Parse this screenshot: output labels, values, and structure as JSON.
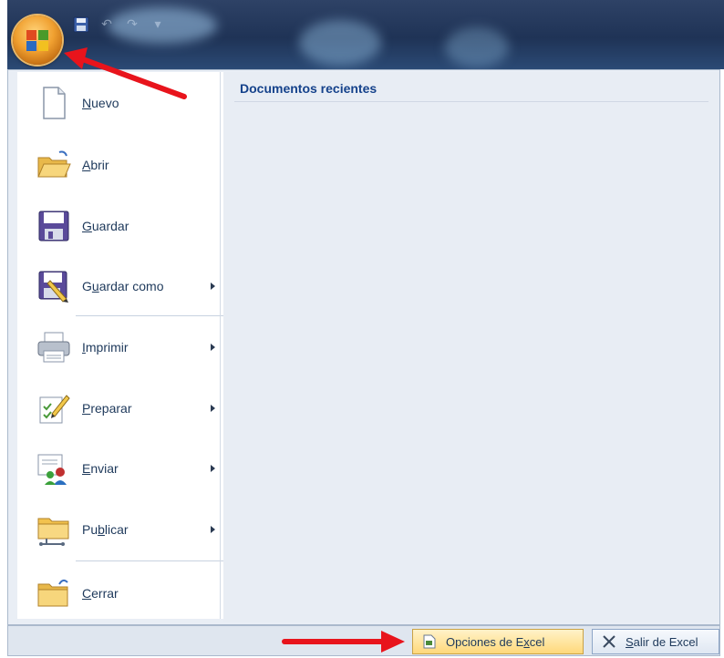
{
  "window": {
    "quick_access_glyphs": [
      "↶",
      "↷",
      "▾"
    ]
  },
  "recent": {
    "title": "Documentos recientes"
  },
  "menu": {
    "items": [
      {
        "key": "nuevo",
        "pre": "",
        "ul": "N",
        "post": "uevo",
        "icon": "new-document-icon",
        "submenu": false
      },
      {
        "key": "abrir",
        "pre": "",
        "ul": "A",
        "post": "brir",
        "icon": "open-folder-icon",
        "submenu": false
      },
      {
        "key": "guardar",
        "pre": "",
        "ul": "G",
        "post": "uardar",
        "icon": "save-icon",
        "submenu": false
      },
      {
        "key": "guardar-como",
        "pre": "G",
        "ul": "u",
        "post": "ardar como",
        "icon": "save-as-icon",
        "submenu": true
      },
      {
        "key": "imprimir",
        "pre": "",
        "ul": "I",
        "post": "mprimir",
        "icon": "printer-icon",
        "submenu": true
      },
      {
        "key": "preparar",
        "pre": "",
        "ul": "P",
        "post": "reparar",
        "icon": "prepare-icon",
        "submenu": true
      },
      {
        "key": "enviar",
        "pre": "",
        "ul": "E",
        "post": "nviar",
        "icon": "send-icon",
        "submenu": true
      },
      {
        "key": "publicar",
        "pre": "Pu",
        "ul": "b",
        "post": "licar",
        "icon": "publish-icon",
        "submenu": true
      },
      {
        "key": "cerrar",
        "pre": "",
        "ul": "C",
        "post": "errar",
        "icon": "close-folder-icon",
        "submenu": false
      }
    ]
  },
  "footer": {
    "opciones": {
      "pre": "Opciones de E",
      "ul": "x",
      "post": "cel"
    },
    "salir": {
      "pre": "",
      "ul": "S",
      "post": "alir de Excel"
    }
  },
  "colors": {
    "accent": "#15428b",
    "annotation_arrow": "#e8141c",
    "highlight_button": "#ffd87a"
  }
}
